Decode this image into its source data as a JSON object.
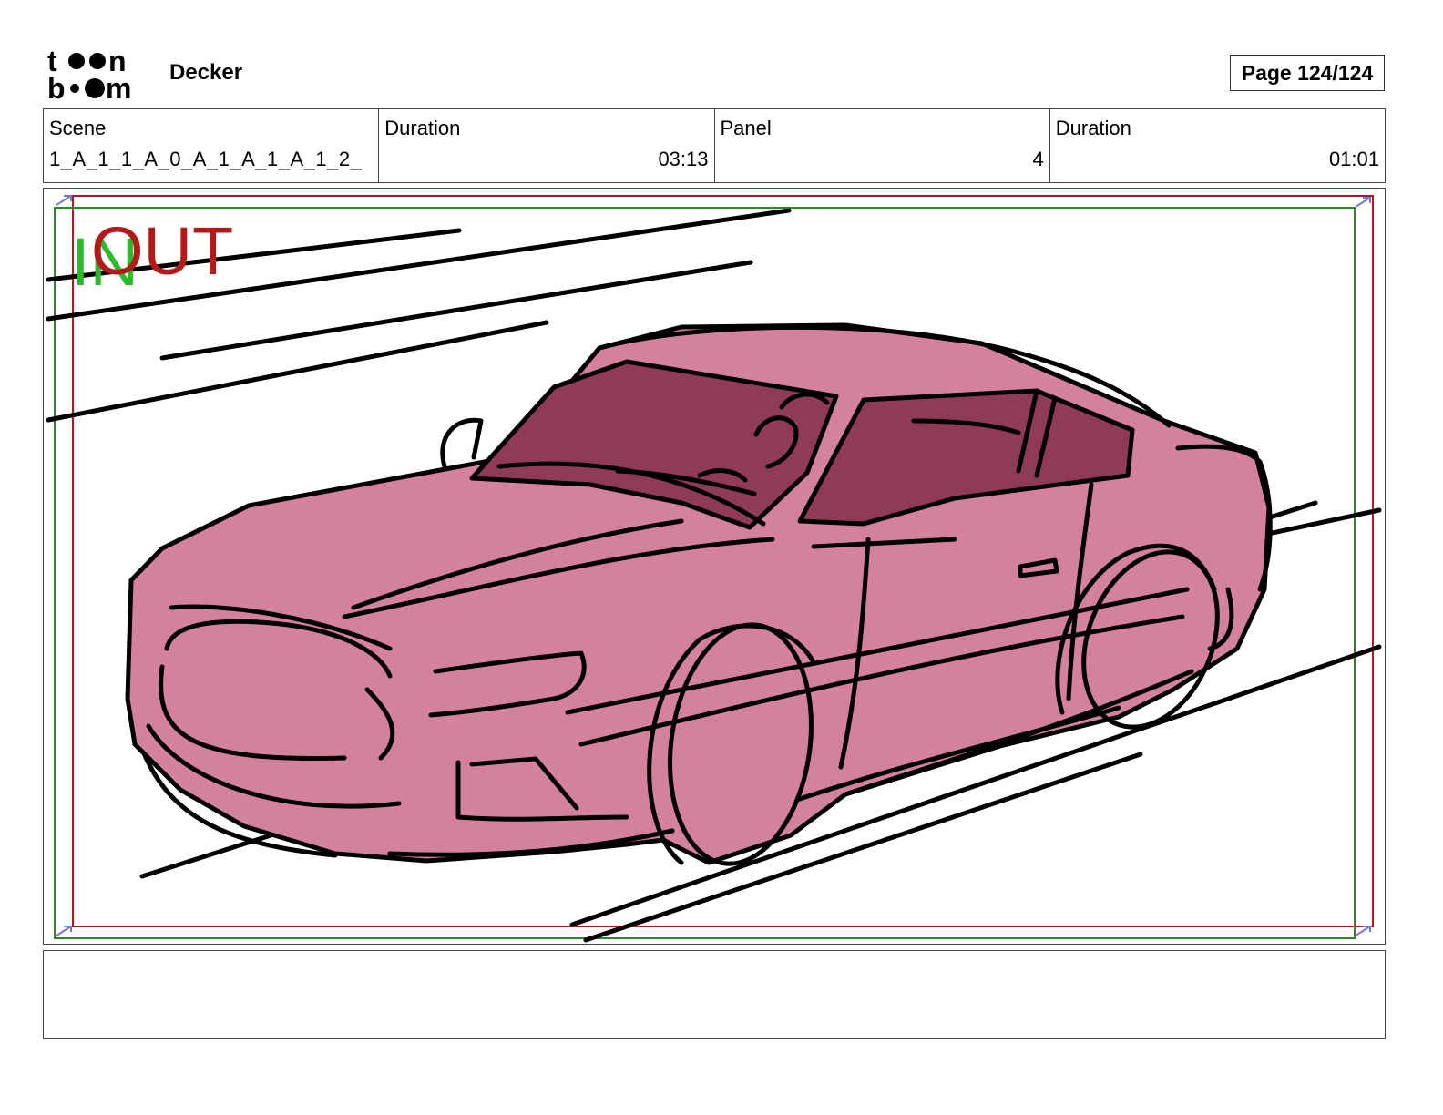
{
  "header": {
    "logo_text_top": "toon",
    "logo_text_bottom": "boom",
    "project_title": "Decker",
    "page_label": "Page 124/124"
  },
  "info": {
    "scene_label": "Scene",
    "scene_value": "1_A_1_1_A_0_A_1_A_1_A_1_2_",
    "scene_duration_label": "Duration",
    "scene_duration_value": "03:13",
    "panel_label": "Panel",
    "panel_value": "4",
    "panel_duration_label": "Duration",
    "panel_duration_value": "01:01"
  },
  "panel": {
    "in_marker": "IN",
    "out_marker": "OUT",
    "colors": {
      "car_body": "#d4829c",
      "car_window": "#8e3a58",
      "ink": "#000000",
      "in_frame": "#2a8a2a",
      "out_frame": "#b31b1b"
    }
  },
  "notes": {
    "text": ""
  }
}
